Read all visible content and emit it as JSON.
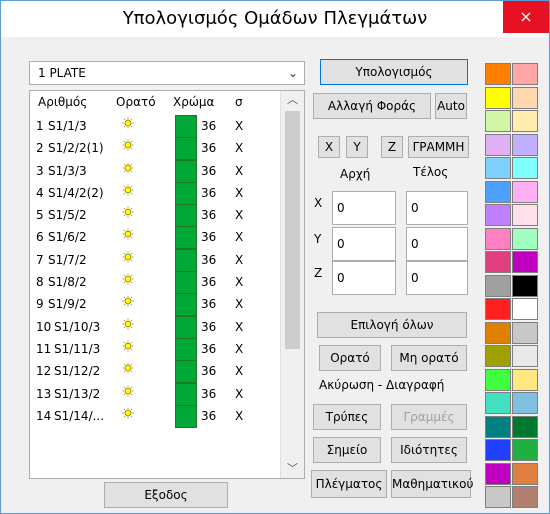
{
  "window": {
    "title": "Υπολογισμός Ομάδων Πλεγμάτων",
    "close_label": "×"
  },
  "dropdown": {
    "selected": "1 PLATE",
    "arrow": "⌄"
  },
  "list": {
    "headers": [
      "Αριθμός",
      "Ορατό",
      "Χρώμα",
      "σ"
    ],
    "rows": [
      {
        "num": "1",
        "name": "S1/1/3",
        "thickness": "36",
        "x": "X"
      },
      {
        "num": "2",
        "name": "S1/2/2(1)",
        "thickness": "36",
        "x": "X"
      },
      {
        "num": "3",
        "name": "S1/3/3",
        "thickness": "36",
        "x": "X"
      },
      {
        "num": "4",
        "name": "S1/4/2(2)",
        "thickness": "36",
        "x": "X"
      },
      {
        "num": "5",
        "name": "S1/5/2",
        "thickness": "36",
        "x": "X"
      },
      {
        "num": "6",
        "name": "S1/6/2",
        "thickness": "36",
        "x": "X"
      },
      {
        "num": "7",
        "name": "S1/7/2",
        "thickness": "36",
        "x": "X"
      },
      {
        "num": "8",
        "name": "S1/8/2",
        "thickness": "36",
        "x": "X"
      },
      {
        "num": "9",
        "name": "S1/9/2",
        "thickness": "36",
        "x": "X"
      },
      {
        "num": "10",
        "name": "S1/10/3",
        "thickness": "36",
        "x": "X"
      },
      {
        "num": "11",
        "name": "S1/11/3",
        "thickness": "36",
        "x": "X"
      },
      {
        "num": "12",
        "name": "S1/12/2",
        "thickness": "36",
        "x": "X"
      },
      {
        "num": "13",
        "name": "S1/13/2",
        "thickness": "36",
        "x": "X"
      },
      {
        "num": "14",
        "name": "S1/14/...",
        "thickness": "36",
        "x": "X"
      }
    ],
    "visible_icon": "sun-icon",
    "row_color": "#00a838"
  },
  "buttons": {
    "calculate": "Υπολογισμός",
    "change_direction": "Αλλαγή Φοράς",
    "auto": "Auto",
    "x": "X",
    "y": "Y",
    "z": "Z",
    "line": "ΓΡΑΜΜΗ",
    "select_all": "Επιλογή όλων",
    "visible": "Ορατό",
    "not_visible": "Μη ορατό",
    "holes": "Τρύπες",
    "lines": "Γραμμές",
    "point": "Σημείο",
    "properties": "Ιδιότητες",
    "meshes": "Πλέγματος",
    "math": "Μαθηματικού",
    "exit": "Εξοδος"
  },
  "coords": {
    "start_label": "Αρχή",
    "end_label": "Τέλος",
    "axis_x": "X",
    "axis_y": "Y",
    "axis_z": "Z",
    "start_x": "0",
    "start_y": "0",
    "start_z": "0",
    "end_x": "0",
    "end_y": "0",
    "end_z": "0"
  },
  "cancel_delete_label": "Ακύρωση - Διαγραφή",
  "palette": [
    [
      "#ff8000",
      "#ffa6a6"
    ],
    [
      "#ffff00",
      "#ffd8b0"
    ],
    [
      "#d2f5a6",
      "#ffedb0"
    ],
    [
      "#e0b0f5",
      "#c0b0ff"
    ],
    [
      "#80d0ff",
      "#80ffff"
    ],
    [
      "#4da0ff",
      "#ffb0f5"
    ],
    [
      "#c080ff",
      "#ffe0e8"
    ],
    [
      "#ff80c0",
      "#a0ffc0"
    ],
    [
      "#e04080",
      "#c000c0"
    ],
    [
      "#a0a0a0",
      "#000000"
    ],
    [
      "#ff2020",
      "#ffffff"
    ],
    [
      "#e08000",
      "#c8c8c8"
    ],
    [
      "#a0a000",
      "#e8e8e8"
    ],
    [
      "#40ff40",
      "#ffe880"
    ],
    [
      "#40e0c0",
      "#80c0e0"
    ],
    [
      "#008080",
      "#007830"
    ],
    [
      "#2040ff",
      "#20b040"
    ],
    [
      "#c000c0",
      "#e08040"
    ],
    [
      "#c8c8c8",
      "#b08070"
    ]
  ]
}
